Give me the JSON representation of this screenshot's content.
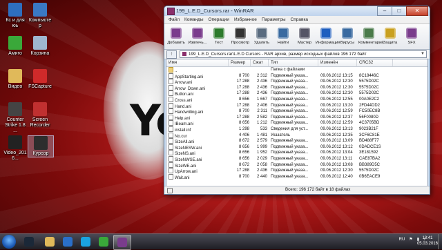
{
  "desktop": {
    "background_text": "Yo",
    "icons": [
      {
        "id": "computer",
        "label": "Кс и для\nюь",
        "color": "#2e6fbf"
      },
      {
        "id": "kompyuter",
        "label": "Компьютер",
        "color": "#3a79c4"
      },
      {
        "id": "amigo",
        "label": "Амиго",
        "color": "#3aa83a"
      },
      {
        "id": "korzina",
        "label": "Корзина",
        "color": "#9fb6cf"
      },
      {
        "id": "video",
        "label": "Видео",
        "color": "#e0b95a"
      },
      {
        "id": "fscapture",
        "label": "FSCapture",
        "color": "#cf2a2a"
      },
      {
        "id": "cs",
        "label": "Counter\nStrike 1.8 ...",
        "color": "#444"
      },
      {
        "id": "screenrec",
        "label": "Screen\nRecorder",
        "color": "#c03030"
      },
      {
        "id": "video2016",
        "label": "Video_2016...",
        "color": "#222"
      },
      {
        "id": "kursor",
        "label": "Курсор",
        "color": "#2d2d2d"
      }
    ]
  },
  "window": {
    "title": "199_L.E.D_Cursors.rar - WinRAR",
    "controls": [
      "–",
      "□",
      "✕"
    ],
    "menu": [
      "Файл",
      "Команды",
      "Операции",
      "Избранное",
      "Параметры",
      "Справка"
    ],
    "toolbar": [
      {
        "label": "Добавить",
        "icon": "add-icon",
        "color": "#7a3c8c"
      },
      {
        "label": "Извлечь...",
        "icon": "extract-icon",
        "color": "#7a3c8c"
      },
      {
        "label": "Тест",
        "icon": "test-icon",
        "color": "#2c7a2c"
      },
      {
        "label": "Просмотр",
        "icon": "view-icon",
        "color": "#333"
      },
      {
        "label": "Удалить",
        "icon": "delete-icon",
        "color": "#5a6c80"
      },
      {
        "label": "Найти",
        "icon": "find-icon",
        "color": "#3a6aa0"
      },
      {
        "label": "Мастер",
        "icon": "wizard-icon",
        "color": "#556"
      },
      {
        "label": "Информация",
        "icon": "info-icon",
        "color": "#1f5fbf"
      },
      {
        "label": "Вирусы",
        "icon": "virus-icon",
        "color": "#3a6aa0"
      },
      {
        "label": "Комментарий",
        "icon": "comment-icon",
        "color": "#4a7a4a"
      },
      {
        "label": "Защита",
        "icon": "protect-icon",
        "color": "#c9a020"
      },
      {
        "label": "SFX",
        "icon": "sfx-icon",
        "color": "#7a3c8c"
      }
    ],
    "address": "199_L.E.D_Cursors.rar\\L.E.D Cursors - RAR архив, размер исходных файлов 196 172 байт",
    "columns": [
      "Имя",
      "Размер",
      "Сжат",
      "Тип",
      "Изменён",
      "CRC32"
    ],
    "files": [
      {
        "name": "..",
        "size": "",
        "packed": "",
        "type": "Папка с файлами",
        "modified": "",
        "crc": ""
      },
      {
        "name": "AppStarting.ani",
        "size": "8 700",
        "packed": "2 312",
        "type": "Подвижный указа...",
        "modified": "09.06.2012 13:15",
        "crc": "8C18446C"
      },
      {
        "name": "Arrow.ani",
        "size": "17 288",
        "packed": "2 436",
        "type": "Подвижный указа...",
        "modified": "09.06.2012 12:30",
        "crc": "5575D02C"
      },
      {
        "name": "Arrow_Down.ani",
        "size": "17 288",
        "packed": "2 436",
        "type": "Подвижный указа...",
        "modified": "09.06.2012 12:30",
        "crc": "5575D02C"
      },
      {
        "name": "Button.ani",
        "size": "17 288",
        "packed": "2 436",
        "type": "Подвижный указа...",
        "modified": "09.06.2012 12:30",
        "crc": "5575D02C"
      },
      {
        "name": "Cross.ani",
        "size": "8 656",
        "packed": "1 667",
        "type": "Подвижный указа...",
        "modified": "09.06.2012 12:55",
        "crc": "00A0E2C2"
      },
      {
        "name": "Hand.ani",
        "size": "17 288",
        "packed": "2 406",
        "type": "Подвижный указа...",
        "modified": "09.06.2012 13:20",
        "crc": "2FD44DD2"
      },
      {
        "name": "Handwriting.ani",
        "size": "8 700",
        "packed": "2 311",
        "type": "Подвижный указа...",
        "modified": "09.06.2012 12:59",
        "crc": "FC50EC8B"
      },
      {
        "name": "Help.ani",
        "size": "17 288",
        "packed": "2 582",
        "type": "Подвижный указа...",
        "modified": "09.06.2012 12:37",
        "crc": "56F0080D"
      },
      {
        "name": "IBeam.ani",
        "size": "8 656",
        "packed": "1 212",
        "type": "Подвижный указа...",
        "modified": "09.06.2012 12:59",
        "crc": "4C3705BD"
      },
      {
        "name": "install.inf",
        "size": "1 298",
        "packed": "533",
        "type": "Сведения для уст...",
        "modified": "09.06.2012 13:13",
        "crc": "9023B21F"
      },
      {
        "name": "No.cur",
        "size": "4 406",
        "packed": "1 481",
        "type": "Указатель",
        "modified": "09.06.2012 12:35",
        "crc": "3CF6C81E"
      },
      {
        "name": "SizeAll.ani",
        "size": "8 672",
        "packed": "2 579",
        "type": "Подвижный указа...",
        "modified": "09.06.2012 13:09",
        "crc": "BD488F77"
      },
      {
        "name": "SizeNESW.ani",
        "size": "8 656",
        "packed": "1 999",
        "type": "Подвижный указа...",
        "modified": "09.06.2012 13:12",
        "crc": "0DADCE1S"
      },
      {
        "name": "SizeNS.ani",
        "size": "8 656",
        "packed": "1 952",
        "type": "Подвижный указа...",
        "modified": "09.06.2012 13:04",
        "crc": "3E181592"
      },
      {
        "name": "SizeNWSE.ani",
        "size": "8 656",
        "packed": "2 029",
        "type": "Подвижный указа...",
        "modified": "09.06.2012 13:11",
        "crc": "CAE87BA2"
      },
      {
        "name": "SizeWE.ani",
        "size": "8 672",
        "packed": "2 058",
        "type": "Подвижный указа...",
        "modified": "09.06.2012 13:08",
        "crc": "BB389D5C"
      },
      {
        "name": "UpArrow.ani",
        "size": "17 288",
        "packed": "2 436",
        "type": "Подвижный указа...",
        "modified": "09.06.2012 12:30",
        "crc": "5575D02C"
      },
      {
        "name": "Wait.ani",
        "size": "8 700",
        "packed": "2 440",
        "type": "Подвижный указа...",
        "modified": "09.06.2012 12:40",
        "crc": "0B6EACE9"
      }
    ],
    "status": "Всего: 196 172 байт в 18 файлах"
  },
  "taskbar": {
    "apps": [
      {
        "id": "steam",
        "color": "#1b2838"
      },
      {
        "id": "explorer",
        "color": "#e0b95a"
      },
      {
        "id": "media",
        "color": "#2a6fc9"
      },
      {
        "id": "skype",
        "color": "#1aa3e0"
      },
      {
        "id": "amigo",
        "color": "#3aa83a"
      },
      {
        "id": "winrar",
        "color": "#7a3c8c"
      }
    ],
    "lang": "RU",
    "time": "18:41",
    "date": "05.03.2016"
  }
}
